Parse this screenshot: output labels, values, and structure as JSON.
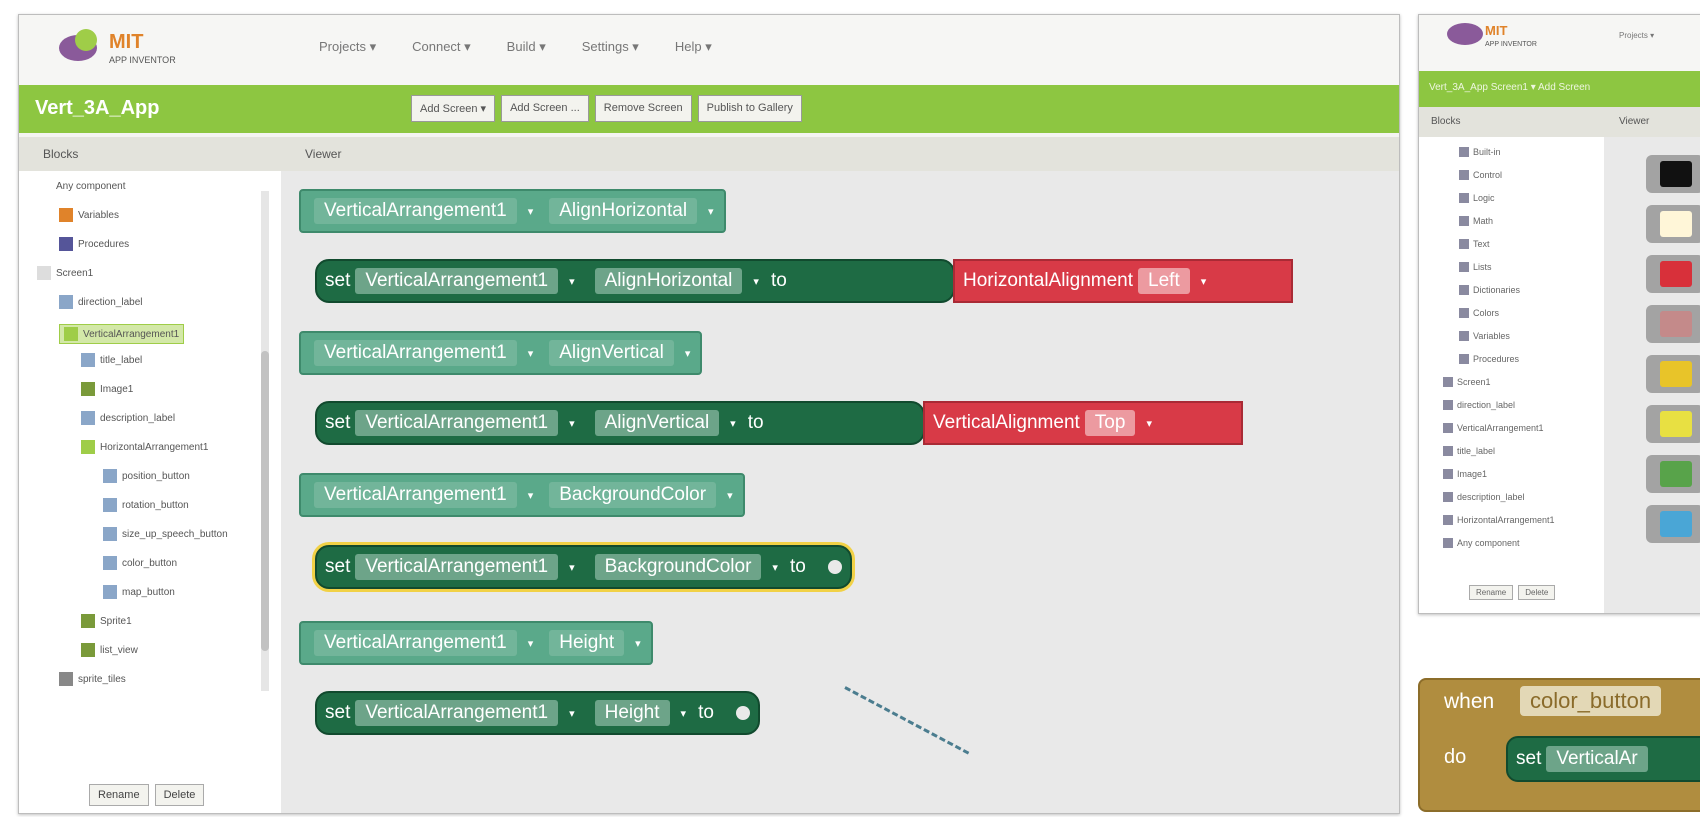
{
  "app": {
    "logo_title": "MIT",
    "logo_subtitle": "APP INVENTOR",
    "menu": [
      "Projects ▾",
      "Connect ▾",
      "Build ▾",
      "Settings ▾",
      "Help ▾"
    ],
    "project_name": "Vert_3A_App",
    "toolbar": [
      "Add Screen ▾",
      "Add Screen ...",
      "Remove Screen",
      "Publish to Gallery"
    ],
    "blocks_header": "Blocks",
    "viewer_header": "Viewer",
    "panel_buttons": [
      "Rename",
      "Delete"
    ]
  },
  "tree": [
    {
      "label": "Any component",
      "icon": "",
      "level": 0
    },
    {
      "label": "Variables",
      "icon": "#e0832a",
      "level": 1
    },
    {
      "label": "Procedures",
      "icon": "#555599",
      "level": 1
    },
    {
      "label": "Screen1",
      "icon": "#dddddd",
      "level": 0
    },
    {
      "label": "direction_label",
      "icon": "#8aa6c8",
      "level": 1
    },
    {
      "label": "VerticalArrangement1",
      "icon": "#9fcd48",
      "level": 1,
      "selected": true
    },
    {
      "label": "title_label",
      "icon": "#8aa6c8",
      "level": 2
    },
    {
      "label": "Image1",
      "icon": "#7a9a3a",
      "level": 2
    },
    {
      "label": "description_label",
      "icon": "#8aa6c8",
      "level": 2
    },
    {
      "label": "HorizontalArrangement1",
      "icon": "#9fcd48",
      "level": 2
    },
    {
      "label": "position_button",
      "icon": "#8aa6c8",
      "level": 3
    },
    {
      "label": "rotation_button",
      "icon": "#8aa6c8",
      "level": 3
    },
    {
      "label": "size_up_speech_button",
      "icon": "#8aa6c8",
      "level": 3
    },
    {
      "label": "color_button",
      "icon": "#8aa6c8",
      "level": 3
    },
    {
      "label": "map_button",
      "icon": "#8aa6c8",
      "level": 3
    },
    {
      "label": "Sprite1",
      "icon": "#7a9a3a",
      "level": 2
    },
    {
      "label": "list_view",
      "icon": "#7a9a3a",
      "level": 2
    },
    {
      "label": "sprite_tiles",
      "icon": "#888888",
      "level": 1
    }
  ],
  "blocks": [
    {
      "kind": "get",
      "component": "VerticalArrangement1",
      "property": "AlignHorizontal"
    },
    {
      "kind": "set",
      "component": "VerticalArrangement1",
      "property": "AlignHorizontal",
      "to": "to",
      "value_label": "HorizontalAlignment",
      "value": "Left"
    },
    {
      "kind": "get",
      "component": "VerticalArrangement1",
      "property": "AlignVertical"
    },
    {
      "kind": "set",
      "component": "VerticalArrangement1",
      "property": "AlignVertical",
      "to": "to",
      "value_label": "VerticalAlignment",
      "value": "Top"
    },
    {
      "kind": "get",
      "component": "VerticalArrangement1",
      "property": "BackgroundColor"
    },
    {
      "kind": "set",
      "component": "VerticalArrangement1",
      "property": "BackgroundColor",
      "to": "to"
    },
    {
      "kind": "get",
      "component": "VerticalArrangement1",
      "property": "Height"
    },
    {
      "kind": "set",
      "component": "VerticalArrangement1",
      "property": "Height",
      "to": "to"
    }
  ],
  "set_keyword": "set",
  "side_window": {
    "logo_title": "MIT",
    "logo_subtitle": "APP INVENTOR",
    "menu": "Projects ▾",
    "green_text": "Vert_3A_App  Screen1 ▾  Add Screen",
    "blocks_header": "Blocks",
    "viewer_header": "Viewer",
    "tree": [
      "Built-in",
      "Control",
      "Logic",
      "Math",
      "Text",
      "Lists",
      "Dictionaries",
      "Colors",
      "Variables",
      "Procedures",
      "Screen1",
      "direction_label",
      "VerticalArrangement1",
      "title_label",
      "Image1",
      "description_label",
      "HorizontalArrangement1",
      "Any component"
    ],
    "buttons": [
      "Rename",
      "Delete"
    ],
    "swatch_colors": [
      "#111111",
      "#fff6d8",
      "#d8303a",
      "#c48a8a",
      "#e8c429",
      "#e8e042",
      "#58a34a",
      "#4aa6d6"
    ]
  },
  "event_block": {
    "when": "when",
    "component": "color_button",
    "do": "do",
    "set": "set",
    "set_component": "VerticalAr"
  }
}
